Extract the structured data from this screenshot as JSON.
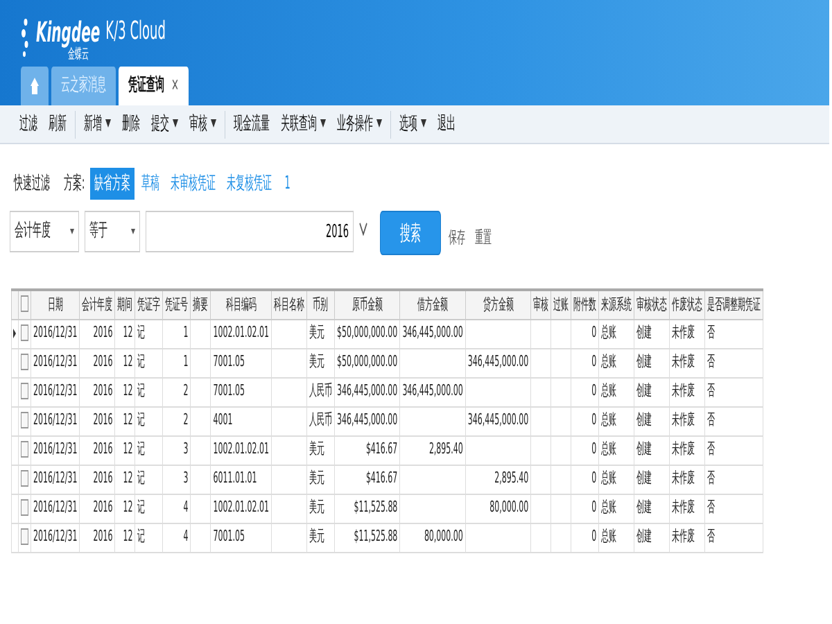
{
  "logo": {
    "brand": "Kingdee",
    "product": "K/3 Cloud",
    "subtitle": "金蝶云"
  },
  "tabs": [
    {
      "kind": "home",
      "selected": false
    },
    {
      "kind": "text",
      "label": "云之家消息",
      "selected": false
    },
    {
      "kind": "text",
      "label": "凭证查询",
      "selected": true,
      "close": "×"
    }
  ],
  "toolbar": [
    [
      {
        "label": "过滤",
        "dropdown": false
      },
      {
        "label": "刷新",
        "dropdown": false
      }
    ],
    [
      {
        "label": "新增",
        "dropdown": true
      },
      {
        "label": "删除",
        "dropdown": false
      },
      {
        "label": "提交",
        "dropdown": true
      },
      {
        "label": "审核",
        "dropdown": true
      }
    ],
    [
      {
        "label": "现金流量",
        "dropdown": false
      },
      {
        "label": "关联查询",
        "dropdown": true
      },
      {
        "label": "业务操作",
        "dropdown": true
      }
    ],
    [
      {
        "label": "选项",
        "dropdown": true
      },
      {
        "label": "退出",
        "dropdown": false
      }
    ]
  ],
  "quick_filter": {
    "title": "快速过滤",
    "scheme_label": "方案:",
    "schemes": [
      {
        "label": "缺省方案",
        "selected": true
      },
      {
        "label": "草稿",
        "selected": false
      },
      {
        "label": "未审核凭证",
        "selected": false
      },
      {
        "label": "未复核凭证",
        "selected": false
      }
    ],
    "count": "1"
  },
  "filter": {
    "field": "会计年度",
    "operator": "等于",
    "value": "2016",
    "search_button": "搜索",
    "save": "保存",
    "reset": "重置"
  },
  "table": {
    "all_checked": false,
    "columns": [
      "日期",
      "会计年度",
      "期间",
      "凭证字",
      "凭证号",
      "摘要",
      "科目编码",
      "科目名称",
      "币别",
      "原币金额",
      "借方金额",
      "贷方金额",
      "审核",
      "过账",
      "附件数",
      "来源系统",
      "审核状态",
      "作废状态",
      "是否调整期凭证"
    ],
    "rows": [
      {
        "current": true,
        "checked": false,
        "cells": [
          "2016/12/31",
          "2016",
          "12",
          "记",
          "1",
          "",
          "1002.01.02.01",
          "",
          "美元",
          "$50,000,000.00",
          "346,445,000.00",
          "",
          "",
          "",
          "0",
          "总账",
          "创建",
          "未作废",
          "否"
        ]
      },
      {
        "current": false,
        "checked": false,
        "cells": [
          "2016/12/31",
          "2016",
          "12",
          "记",
          "1",
          "",
          "7001.05",
          "",
          "美元",
          "$50,000,000.00",
          "",
          "346,445,000.00",
          "",
          "",
          "0",
          "总账",
          "创建",
          "未作废",
          "否"
        ]
      },
      {
        "current": false,
        "checked": false,
        "cells": [
          "2016/12/31",
          "2016",
          "12",
          "记",
          "2",
          "",
          "7001.05",
          "",
          "人民币",
          "346,445,000.00",
          "346,445,000.00",
          "",
          "",
          "",
          "0",
          "总账",
          "创建",
          "未作废",
          "否"
        ]
      },
      {
        "current": false,
        "checked": false,
        "cells": [
          "2016/12/31",
          "2016",
          "12",
          "记",
          "2",
          "",
          "4001",
          "",
          "人民币",
          "346,445,000.00",
          "",
          "346,445,000.00",
          "",
          "",
          "0",
          "总账",
          "创建",
          "未作废",
          "否"
        ]
      },
      {
        "current": false,
        "checked": false,
        "cells": [
          "2016/12/31",
          "2016",
          "12",
          "记",
          "3",
          "",
          "1002.01.02.01",
          "",
          "美元",
          "$416.67",
          "2,895.40",
          "",
          "",
          "",
          "0",
          "总账",
          "创建",
          "未作废",
          "否"
        ]
      },
      {
        "current": false,
        "checked": false,
        "cells": [
          "2016/12/31",
          "2016",
          "12",
          "记",
          "3",
          "",
          "6011.01.01",
          "",
          "美元",
          "$416.67",
          "",
          "2,895.40",
          "",
          "",
          "0",
          "总账",
          "创建",
          "未作废",
          "否"
        ]
      },
      {
        "current": false,
        "checked": false,
        "cells": [
          "2016/12/31",
          "2016",
          "12",
          "记",
          "4",
          "",
          "1002.01.02.01",
          "",
          "美元",
          "$11,525.88",
          "",
          "80,000.00",
          "",
          "",
          "0",
          "总账",
          "创建",
          "未作废",
          "否"
        ]
      },
      {
        "current": false,
        "checked": false,
        "cells": [
          "2016/12/31",
          "2016",
          "12",
          "记",
          "4",
          "",
          "7001.05",
          "",
          "美元",
          "$11,525.88",
          "80,000.00",
          "",
          "",
          "",
          "0",
          "总账",
          "创建",
          "未作废",
          "否"
        ]
      }
    ]
  }
}
